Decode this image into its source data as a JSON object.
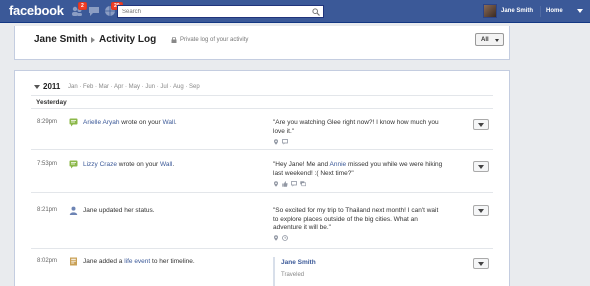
{
  "topbar": {
    "logo": "facebook",
    "friend_requests_count": "2",
    "notifications_count": "20",
    "search_placeholder": "Search",
    "user_name": "Jane Smith",
    "home_label": "Home"
  },
  "header": {
    "name": "Jane Smith",
    "title": "Activity Log",
    "privacy_note": "Private log of your activity",
    "filter_label": "All"
  },
  "timeline": {
    "year": "2011",
    "months": "Jan · Feb · Mar · Apr · May · Jun · Jul · Aug · Sep",
    "day_label": "Yesterday",
    "entries": [
      {
        "time": "8:29pm",
        "icon": "wall-post-icon",
        "actor": "Arielle Aryah",
        "mid": " wrote on your ",
        "target": "Wall",
        "end": ".",
        "content": "\"Are you watching Glee right now?! I know how much you love it.\""
      },
      {
        "time": "7:53pm",
        "icon": "wall-post-icon",
        "actor": "Lizzy Craze",
        "mid": " wrote on your ",
        "target": "Wall",
        "end": ".",
        "content_a": "\"Hey Jane! Me and ",
        "content_link": "Annie",
        "content_b": " missed you while we were hiking last weekend! :( Next time?\""
      },
      {
        "time": "8:21pm",
        "icon": "status-person-icon",
        "text": "Jane updated her status.",
        "content": "\"So excited for my trip to Thailand next month! I can't wait to explore places outside of the big cities. What an adventure it will be.\""
      },
      {
        "time": "8:02pm",
        "icon": "life-event-icon",
        "text_a": "Jane added a ",
        "link": "life event",
        "text_b": " to her timeline.",
        "story_name": "Jane Smith",
        "story_sub": "Traveled"
      }
    ]
  },
  "colors": {
    "brand_blue": "#3b5998",
    "badge_red": "#f03d25",
    "page_bg": "#e9ebee"
  }
}
